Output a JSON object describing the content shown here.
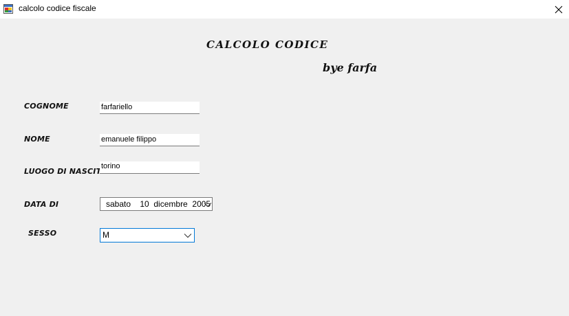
{
  "window": {
    "title": "calcolo codice fiscale",
    "icon": "windows-form-icon",
    "close_icon": "close-icon"
  },
  "header": {
    "title": "CALCOLO CODICE",
    "subtitle": "bye farfa"
  },
  "form": {
    "cognome": {
      "label": "COGNOME",
      "value": "farfariello"
    },
    "nome": {
      "label": "NOME",
      "value": "emanuele filippo"
    },
    "luogo": {
      "label": "LUOGO DI NASCITA",
      "value": "torino"
    },
    "data": {
      "label": "DATA DI",
      "value": "sabato    10  dicembre  2005"
    },
    "sesso": {
      "label": "SESSO",
      "value": "M"
    }
  },
  "colors": {
    "background": "#f0f0f0",
    "focus_border": "#0078d7"
  }
}
